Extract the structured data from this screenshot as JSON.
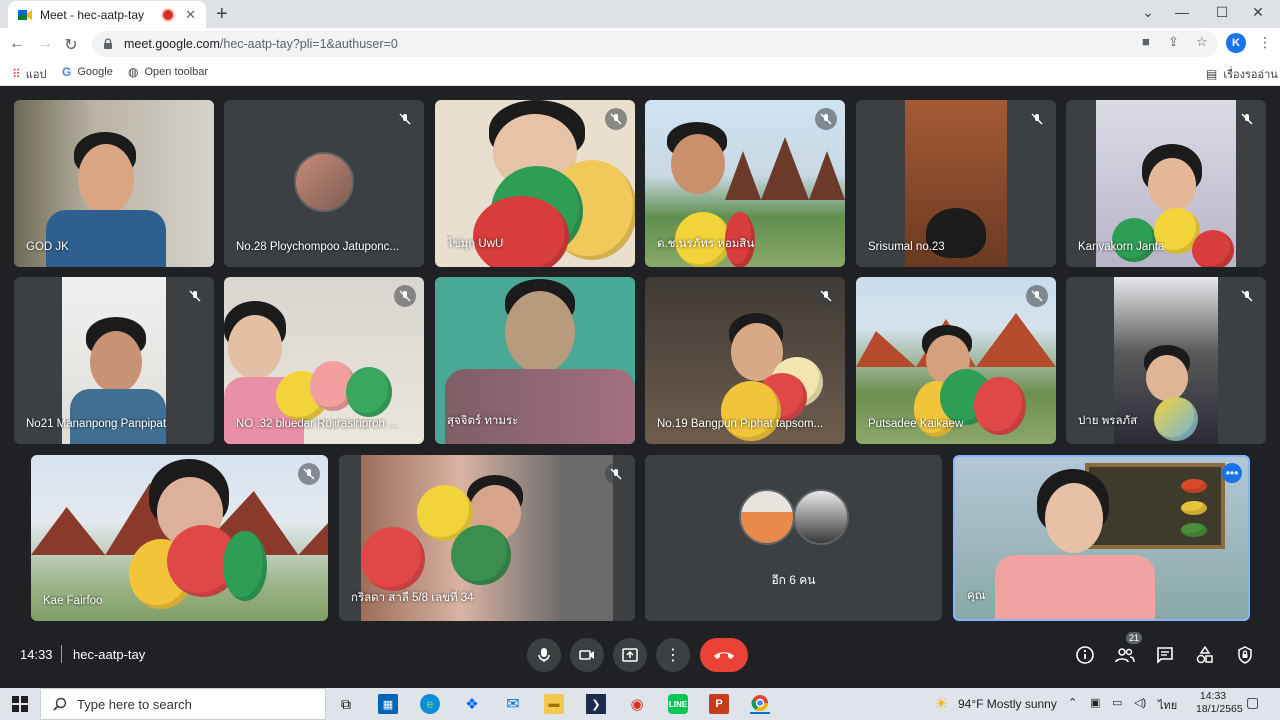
{
  "browser": {
    "tab_title": "Meet - hec-aatp-tay",
    "url_host": "meet.google.com",
    "url_path": "/hec-aatp-tay?pli=1&authuser=0",
    "profile_initial": "K",
    "bookmarks": [
      "แอป",
      "Google",
      "Open toolbar"
    ],
    "reading_list": "เรื่องรออ่าน"
  },
  "participants": [
    "GOD JK",
    "No.28 Ploychompoo Jatuponc...",
    "ไข่มุก UwU",
    "ด.ช.นรภัทร หอมสิน",
    "Srisumal no.23",
    "Kanyakorn Janta",
    "No21 Mananpong Panpipat",
    "NO .32 bluedar Rujirasiripron ...",
    "สุจจิตร์ ทามระ",
    "No.19 Bangpun Piphat tapsom...",
    "Putsadee Kaikaew",
    "ปาย พรลภัส",
    "Kae Fairfoo",
    "กริลดา สาลี 5/8 เลขที่ 34",
    "อีก 6 คน",
    "คุณ"
  ],
  "meeting": {
    "time": "14:33",
    "code": "hec-aatp-tay",
    "people_count": "21"
  },
  "taskbar": {
    "search_placeholder": "Type here to search",
    "weather": "94°F  Mostly sunny",
    "lang": "ไทย",
    "clock_time": "14:33",
    "clock_date": "18/1/2565"
  },
  "colors": {
    "meet_bg": "#202124",
    "tile_bg": "#3c4043",
    "end_call": "#ea4335",
    "active_speaker": "#8ab4f8"
  }
}
